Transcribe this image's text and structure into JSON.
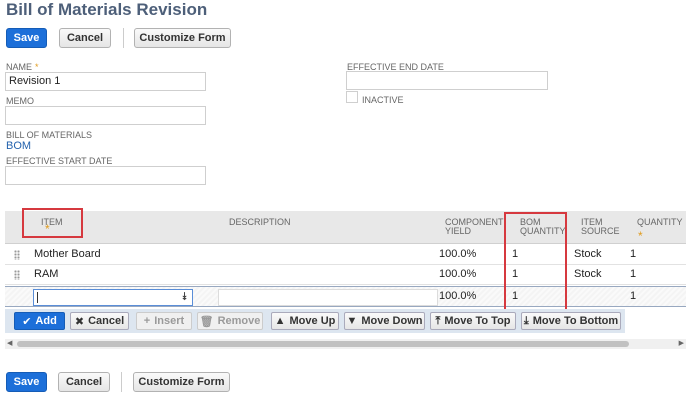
{
  "page": {
    "title": "Bill of Materials Revision"
  },
  "toolbar": {
    "save": "Save",
    "cancel": "Cancel",
    "customize": "Customize Form"
  },
  "form": {
    "name_label": "NAME",
    "name_required": "*",
    "name_value": "Revision 1",
    "memo_label": "MEMO",
    "memo_value": "",
    "bom_label": "BILL OF MATERIALS",
    "bom_value": "BOM",
    "start_label": "EFFECTIVE START DATE",
    "start_value": "",
    "end_label": "EFFECTIVE END DATE",
    "end_value": "",
    "inactive_label": "INACTIVE"
  },
  "grid": {
    "headers": {
      "item": "ITEM",
      "item_req": "*",
      "description": "DESCRIPTION",
      "yield_1": "COMPONENT",
      "yield_2": "YIELD",
      "bomqty_1": "BOM",
      "bomqty_2": "QUANTITY",
      "source_1": "ITEM",
      "source_2": "SOURCE",
      "qty": "QUANTITY",
      "qty_req": "*"
    },
    "rows": [
      {
        "item": "Mother Board",
        "yield": "100.0%",
        "bom_qty": "1",
        "source": "Stock",
        "qty": "1"
      },
      {
        "item": "RAM",
        "yield": "100.0%",
        "bom_qty": "1",
        "source": "Stock",
        "qty": "1"
      }
    ],
    "edit_row": {
      "item": "",
      "yield": "100.0%",
      "bom_qty": "1",
      "qty": "1"
    },
    "buttons": {
      "add": "Add",
      "cancel": "Cancel",
      "insert": "Insert",
      "remove": "Remove",
      "move_up": "Move Up",
      "move_down": "Move Down",
      "move_top": "Move To Top",
      "move_bottom": "Move To Bottom"
    }
  },
  "colors": {
    "primary": "#1c6fd9",
    "highlight": "#d6393f",
    "title": "#4d5f79",
    "link": "#2563ae"
  },
  "icons": {
    "add": "check-icon",
    "cancel": "x-icon",
    "insert": "plus-icon",
    "remove": "trash-icon",
    "move_up": "arrow-up-icon",
    "move_down": "arrow-down-icon",
    "move_top": "arrow-to-top-icon",
    "move_bottom": "arrow-to-bottom-icon"
  }
}
